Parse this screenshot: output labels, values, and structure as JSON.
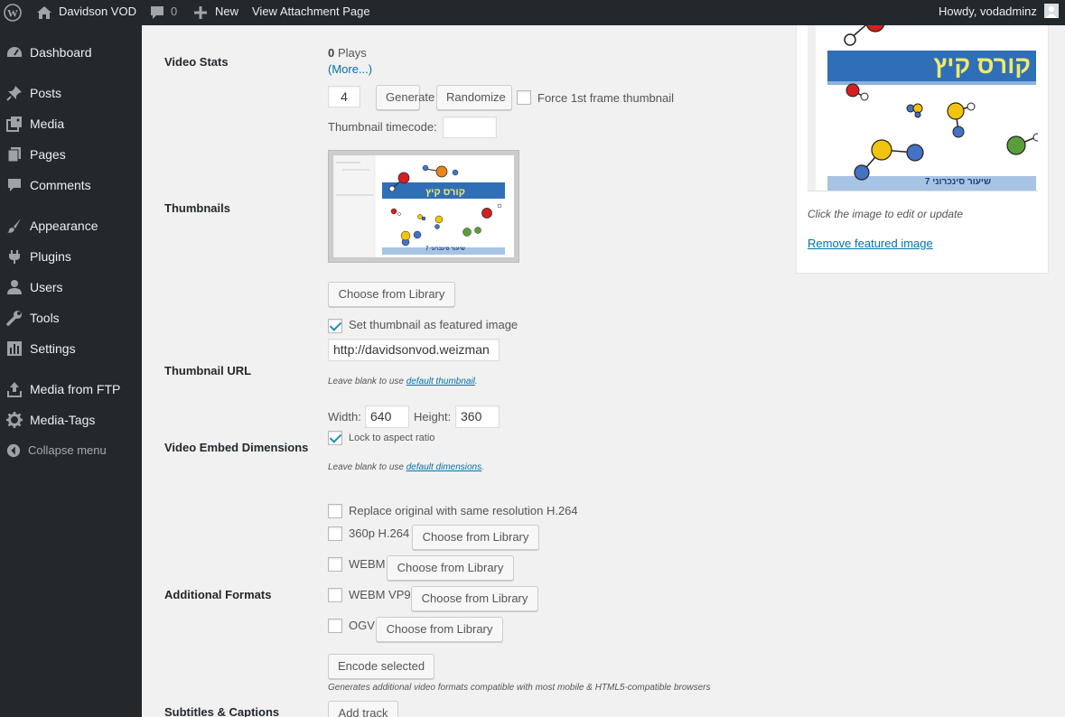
{
  "adminbar": {
    "site_name": "Davidson VOD",
    "comments_count": "0",
    "new_label": "New",
    "view_attachment": "View Attachment Page",
    "howdy": "Howdy, vodadminz"
  },
  "sidebar": {
    "items": [
      {
        "label": "Dashboard",
        "icon": "dashboard-icon"
      },
      {
        "label": "Posts",
        "icon": "pin-icon"
      },
      {
        "label": "Media",
        "icon": "media-icon"
      },
      {
        "label": "Pages",
        "icon": "pages-icon"
      },
      {
        "label": "Comments",
        "icon": "comments-icon"
      },
      {
        "label": "Appearance",
        "icon": "brush-icon"
      },
      {
        "label": "Plugins",
        "icon": "plugin-icon"
      },
      {
        "label": "Users",
        "icon": "users-icon"
      },
      {
        "label": "Tools",
        "icon": "wrench-icon"
      },
      {
        "label": "Settings",
        "icon": "settings-icon"
      },
      {
        "label": "Media from FTP",
        "icon": "upload-icon"
      },
      {
        "label": "Media-Tags",
        "icon": "gear-icon"
      }
    ],
    "collapse_label": "Collapse menu"
  },
  "video_stats": {
    "label": "Video Stats",
    "plays_count": "0",
    "plays_label": "Plays",
    "more_link": "(More...)"
  },
  "thumbnails": {
    "label": "Thumbnails",
    "count_value": "4",
    "generate": "Generate",
    "randomize": "Randomize",
    "force_first": "Force 1st frame thumbnail",
    "timecode_label": "Thumbnail timecode:",
    "timecode_value": "",
    "choose": "Choose from Library",
    "set_featured": "Set thumbnail as featured image",
    "image_title": "קורס קיץ",
    "image_footer": "שיעור סינכרוני 7"
  },
  "thumbnail_url": {
    "label": "Thumbnail URL",
    "value": "http://davidsonvod.weizman",
    "hint_prefix": "Leave blank to use ",
    "hint_link": "default thumbnail",
    "hint_suffix": "."
  },
  "embed": {
    "label": "Video Embed Dimensions",
    "width_label": "Width:",
    "width_value": "640",
    "height_label": "Height:",
    "height_value": "360",
    "lock_label": "Lock to aspect ratio",
    "hint_prefix": "Leave blank to use ",
    "hint_link": "default dimensions",
    "hint_suffix": "."
  },
  "formats": {
    "label": "Additional Formats",
    "replace_original": "Replace original with same resolution H.264",
    "f360": "360p H.264",
    "webm": "WEBM",
    "webm_vp9": "WEBM VP9",
    "ogv": "OGV",
    "choose": "Choose from Library",
    "encode": "Encode selected",
    "hint": "Generates additional video formats compatible with most mobile & HTML5-compatible browsers"
  },
  "subtitles": {
    "label": "Subtitles & Captions",
    "add_track": "Add track"
  },
  "featured": {
    "image_title": "קורס קיץ",
    "image_footer": "שיעור סינכרוני 7",
    "hint": "Click the image to edit or update",
    "remove": "Remove featured image"
  },
  "colors": {
    "adminbar_bg": "#23282d",
    "sidebar_bg": "#23282d",
    "link": "#0073aa",
    "page_bg": "#f1f1f1"
  }
}
